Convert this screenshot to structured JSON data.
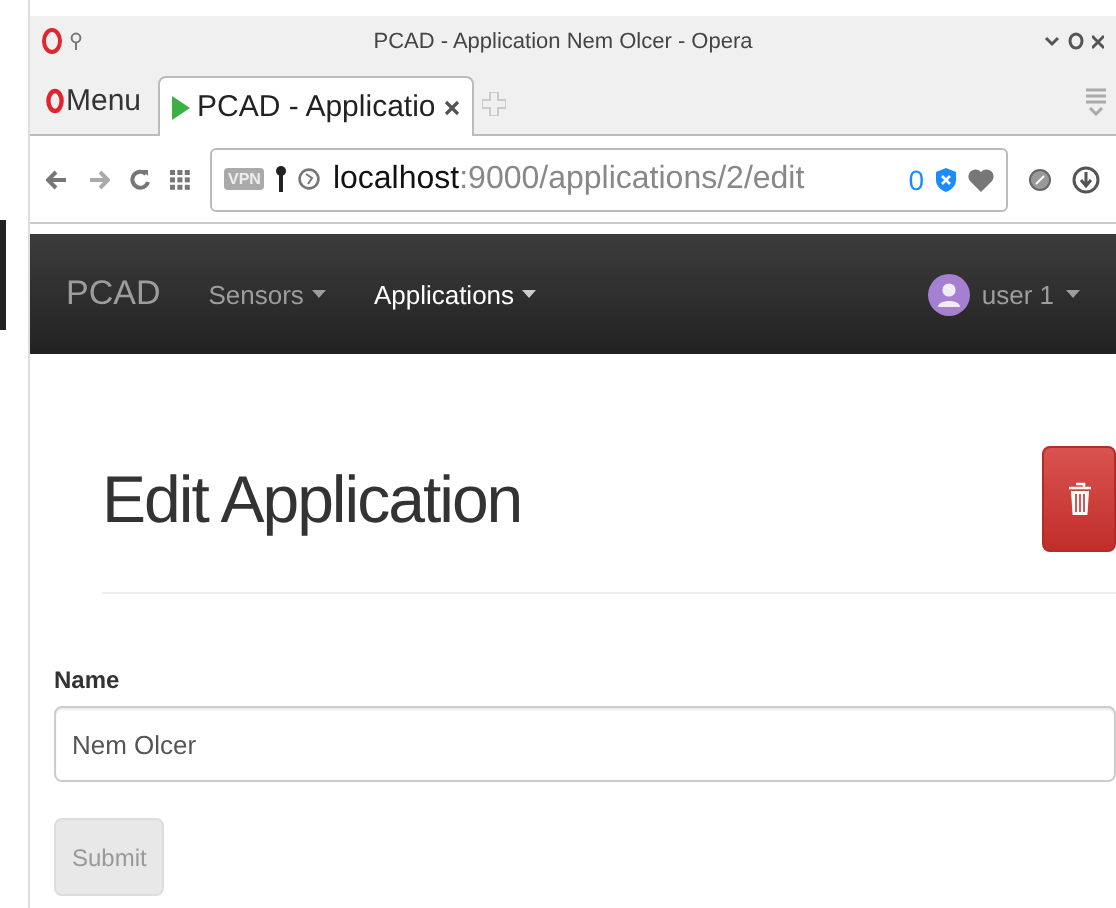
{
  "window": {
    "title": "PCAD - Application Nem Olcer - Opera"
  },
  "browser": {
    "menu": "Menu",
    "tabs": [
      {
        "label": "PCAD - Applicatio",
        "selected": true
      }
    ],
    "address": {
      "host": "localhost",
      "path": ":9000/applications/2/edit",
      "vpn": "VPN",
      "blocked_count": "0"
    }
  },
  "navbar": {
    "brand": "PCAD",
    "items": [
      {
        "label": "Sensors",
        "selected": false
      },
      {
        "label": "Applications",
        "selected": true
      }
    ],
    "user": "user 1"
  },
  "page": {
    "title": "Edit Application",
    "form": {
      "label": "Name",
      "value": "Nem Olcer",
      "submit": {
        "label": "Submit",
        "disabled": true
      }
    }
  }
}
